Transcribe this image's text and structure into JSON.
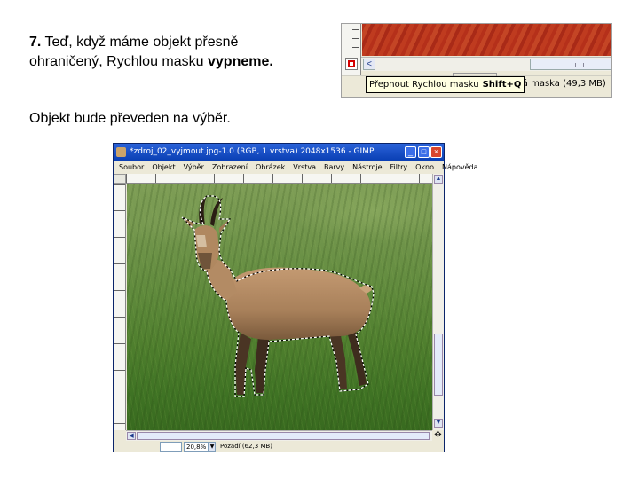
{
  "slide": {
    "step_number": "7.",
    "line1_text": "Teď, když máme objekt přesně",
    "line2_text": "ohraničený, Rychlou masku",
    "line2_bold": "vypneme.",
    "line3_text": "Objekt bude převeden na výběr."
  },
  "inset": {
    "tooltip_text": "Přepnout Rychlou masku",
    "tooltip_shortcut": "Shift+Q",
    "status_text": "lá maska (49,3 MB)",
    "quickmask_color": "#d40000",
    "canvas_color": "#b5301a"
  },
  "gimp": {
    "title": "*zdroj_02_vyjmout.jpg-1.0 (RGB, 1 vrstva) 2048x1536 - GIMP",
    "menu": [
      "Soubor",
      "Objekt",
      "Výběr",
      "Zobrazení",
      "Obrázek",
      "Vrstva",
      "Barvy",
      "Nástroje",
      "Filtry",
      "Okno",
      "Nápověda"
    ],
    "zoom_value": "20,8%",
    "status_text": "Pozadí (62,3 MB)",
    "navigate_icon": "move-icon",
    "titlebar_color": "#0a3fb4"
  }
}
